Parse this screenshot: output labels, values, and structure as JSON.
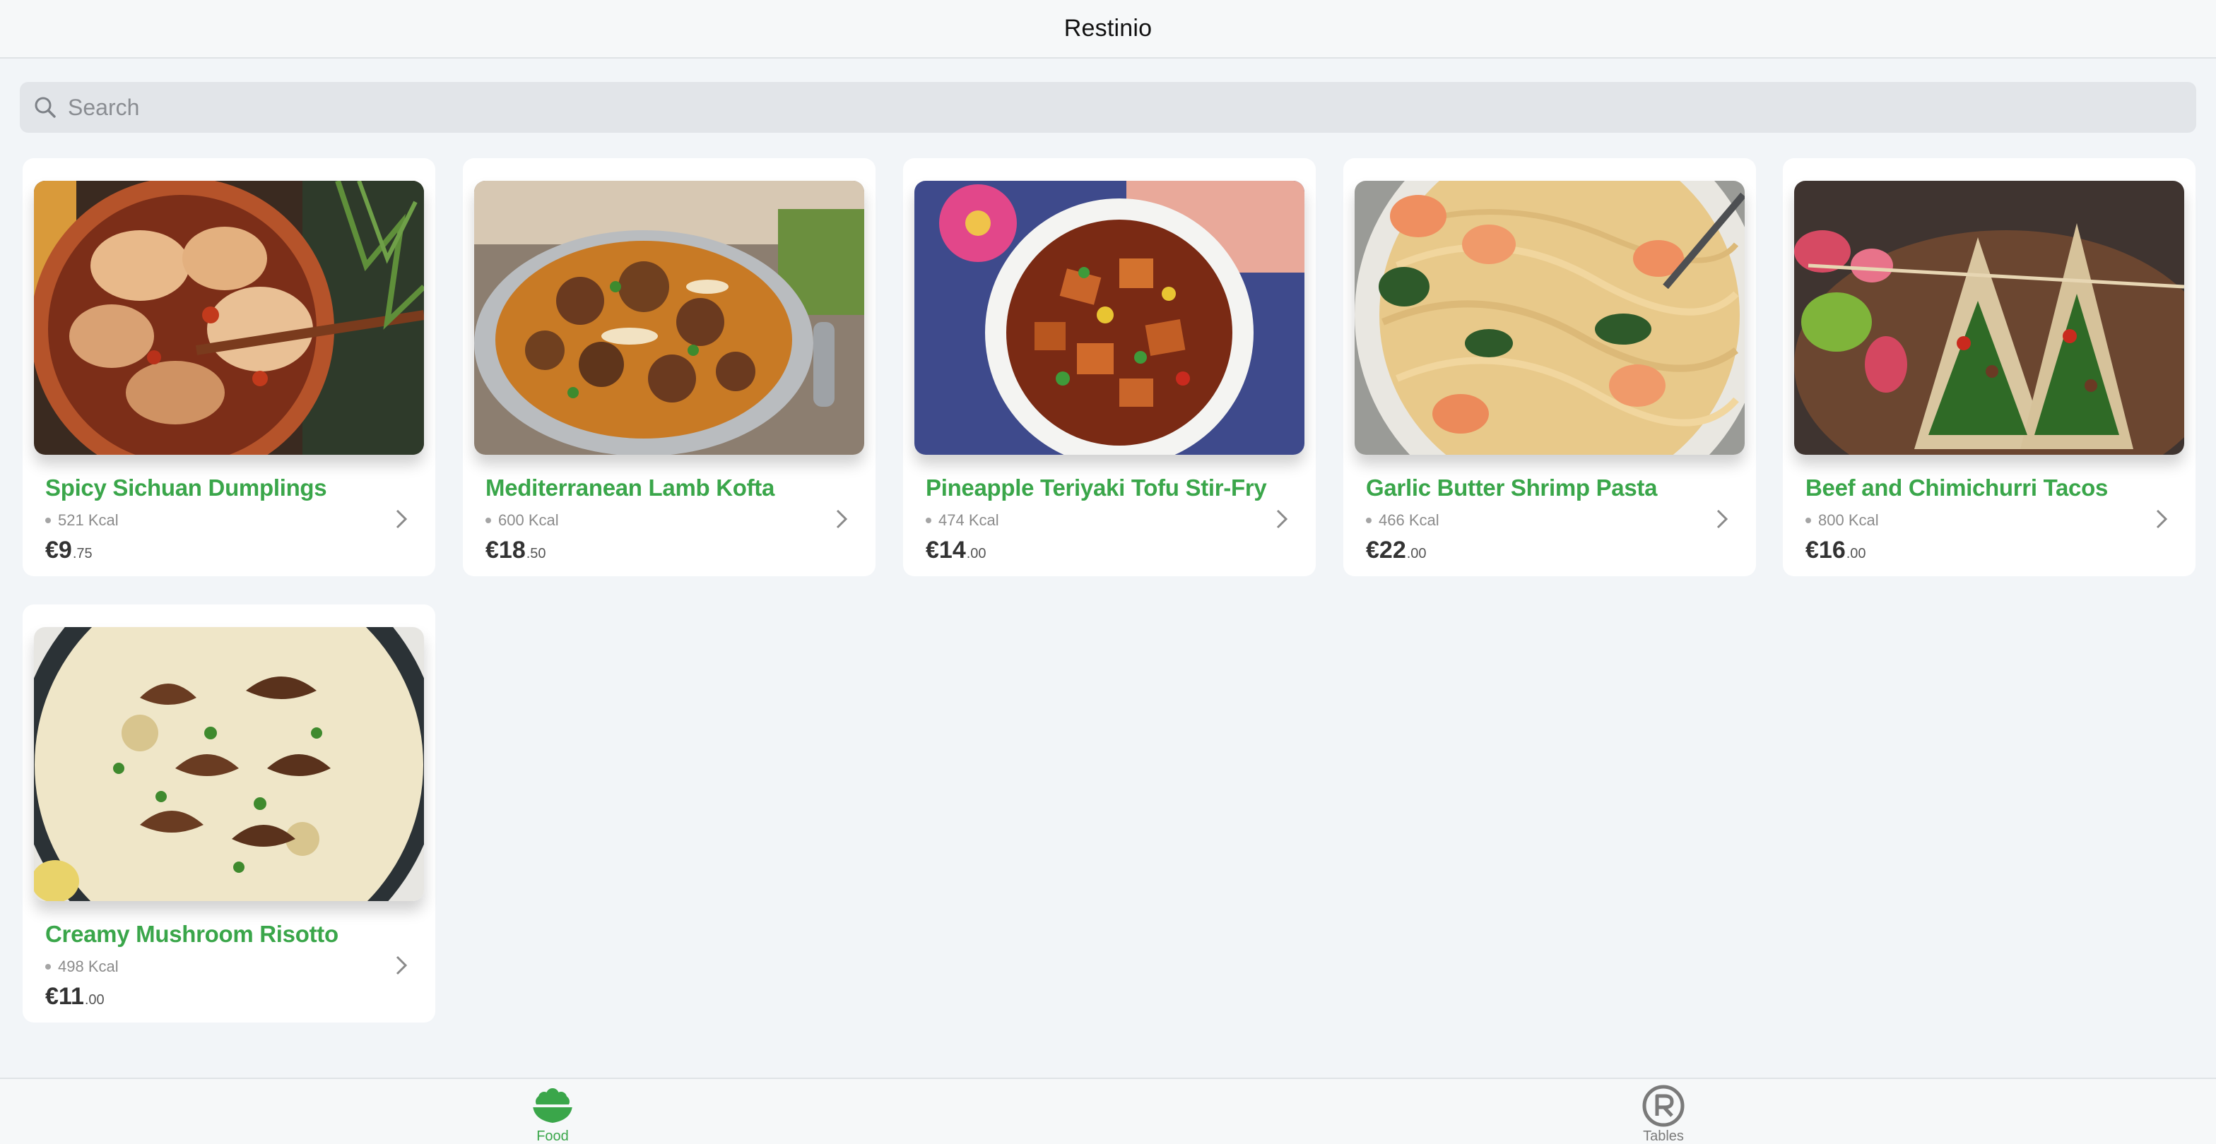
{
  "header": {
    "title": "Restinio"
  },
  "search": {
    "placeholder": "Search"
  },
  "menu": {
    "items": [
      {
        "name": "Spicy Sichuan Dumplings",
        "kcal": "521 Kcal",
        "price_main": "€9",
        "price_cents": ".75",
        "image": "dumplings-photo"
      },
      {
        "name": "Mediterranean Lamb Kofta",
        "kcal": "600 Kcal",
        "price_main": "€18",
        "price_cents": ".50",
        "image": "kofta-photo"
      },
      {
        "name": "Pineapple Teriyaki Tofu Stir-Fry",
        "kcal": "474 Kcal",
        "price_main": "€14",
        "price_cents": ".00",
        "image": "tofu-stirfry-photo"
      },
      {
        "name": "Garlic Butter Shrimp Pasta",
        "kcal": "466 Kcal",
        "price_main": "€22",
        "price_cents": ".00",
        "image": "shrimp-pasta-photo"
      },
      {
        "name": "Beef and Chimichurri Tacos",
        "kcal": "800 Kcal",
        "price_main": "€16",
        "price_cents": ".00",
        "image": "tacos-photo"
      },
      {
        "name": "Creamy Mushroom Risotto",
        "kcal": "498 Kcal",
        "price_main": "€11",
        "price_cents": ".00",
        "image": "risotto-photo"
      }
    ]
  },
  "tabbar": {
    "tabs": [
      {
        "label": "Food",
        "icon": "food-bowl-icon",
        "active": true
      },
      {
        "label": "Tables",
        "icon": "registered-r-icon",
        "active": false
      }
    ]
  },
  "colors": {
    "accent": "#3aa64a",
    "background": "#f2f5f8",
    "card": "#ffffff",
    "search_bg": "#e2e5e9"
  }
}
